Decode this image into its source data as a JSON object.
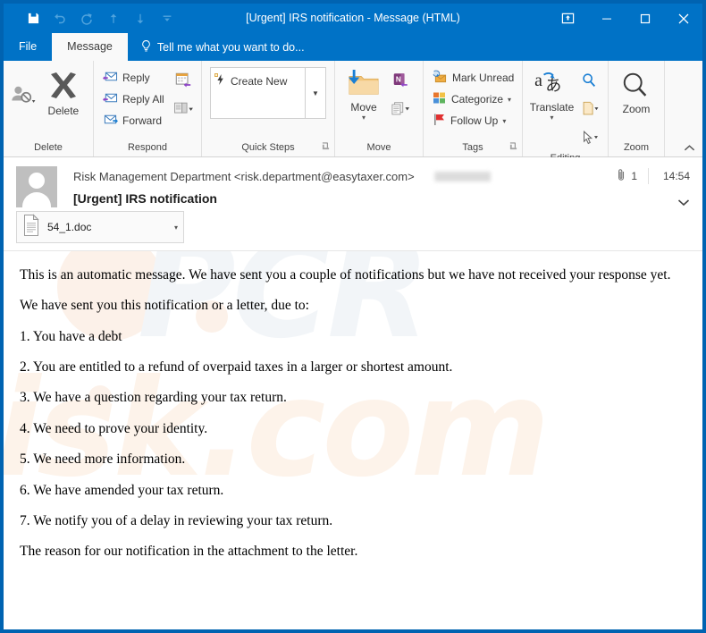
{
  "window": {
    "title": "[Urgent] IRS notification - Message (HTML)",
    "border_color": "#0063B1",
    "titlebar_color": "#0072C6"
  },
  "quick_access_toolbar": {
    "buttons": [
      {
        "name": "save-button",
        "icon": "save-icon",
        "label": "Save",
        "enabled": true
      },
      {
        "name": "undo-button",
        "icon": "undo-icon",
        "label": "Undo",
        "enabled": false
      },
      {
        "name": "redo-button",
        "icon": "redo-icon",
        "label": "Redo",
        "enabled": false
      },
      {
        "name": "previous-item-button",
        "icon": "arrow-up-icon",
        "label": "Previous Item",
        "enabled": false
      },
      {
        "name": "next-item-button",
        "icon": "arrow-down-icon",
        "label": "Next Item",
        "enabled": false
      },
      {
        "name": "customize-qat-button",
        "icon": "chevron-down-icon",
        "label": "Customize Quick Access Toolbar",
        "enabled": false
      }
    ]
  },
  "window_controls": {
    "ribbon_display_options": "ribbon-display-options-icon",
    "minimize": "minimize-icon",
    "maximize": "maximize-icon",
    "close": "close-icon"
  },
  "tabs": {
    "file": "File",
    "message": "Message",
    "active": "Message",
    "tell_me": "Tell me what you want to do...",
    "tell_me_icon": "lightbulb-icon"
  },
  "ribbon": {
    "collapse_icon": "chevron-up-icon",
    "groups": [
      {
        "key": "delete",
        "label": "Delete",
        "ignore_label": "Ignore",
        "delete_label": "Delete",
        "ignore_icon": "ignore-person-icon",
        "delete_icon": "delete-x-icon"
      },
      {
        "key": "respond",
        "label": "Respond",
        "items": [
          {
            "label": "Reply",
            "icon": "reply-envelope-icon"
          },
          {
            "label": "Reply All",
            "icon": "reply-all-envelope-icon"
          },
          {
            "label": "Forward",
            "icon": "forward-envelope-icon"
          }
        ],
        "extra_icons": [
          {
            "name": "meeting-icon",
            "label": "Meeting"
          },
          {
            "name": "more-respond-actions-icon",
            "label": "More Respond Actions"
          }
        ]
      },
      {
        "key": "quick-steps",
        "label": "Quick Steps",
        "item_label": "Create New",
        "item_icon": "quick-step-lightning-icon",
        "more_icon": "chevron-down-icon",
        "launcher_icon": "dialog-launcher-icon"
      },
      {
        "key": "move",
        "label": "Move",
        "move_label": "Move",
        "move_icon": "move-folder-icon",
        "extra_icons": [
          {
            "name": "onenote-icon",
            "label": "OneNote"
          },
          {
            "name": "rules-icon",
            "label": "Rules"
          }
        ]
      },
      {
        "key": "tags",
        "label": "Tags",
        "items": [
          {
            "label": "Mark Unread",
            "icon": "mark-unread-icon",
            "has_caret": false
          },
          {
            "label": "Categorize",
            "icon": "categorize-icon",
            "has_caret": true
          },
          {
            "label": "Follow Up",
            "icon": "follow-up-flag-icon",
            "has_caret": true
          }
        ],
        "launcher_icon": "dialog-launcher-icon"
      },
      {
        "key": "editing",
        "label": "Editing",
        "translate_label": "Translate",
        "translate_icon": "translate-icon",
        "extra_icons": [
          {
            "name": "find-icon",
            "label": "Find"
          },
          {
            "name": "related-icon",
            "label": "Related"
          },
          {
            "name": "select-icon",
            "label": "Select"
          }
        ]
      },
      {
        "key": "zoom",
        "label": "Zoom",
        "zoom_label": "Zoom",
        "zoom_icon": "magnifier-icon"
      }
    ]
  },
  "message": {
    "avatar_icon": "contact-avatar-icon",
    "sender": "Risk Management Department <risk.department@easytaxer.com>",
    "recipient_redacted": true,
    "attachment_count": "1",
    "attachment_icon": "paperclip-icon",
    "time": "14:54",
    "subject": "[Urgent] IRS notification",
    "expand_icon": "chevron-down-icon",
    "attachments": [
      {
        "filename": "54_1.doc",
        "icon": "document-icon",
        "caret_icon": "chevron-down-icon"
      }
    ],
    "body_paragraphs": [
      "This is an automatic message. We have sent you a couple of notifications but we have not received your response yet.",
      "We have sent you this notification or a letter, due to:",
      "1. You have a debt",
      "2. You are entitled to a refund of overpaid taxes in a larger or shortest amount.",
      "3. We have a question regarding your tax return.",
      "4. We need to prove your identity.",
      "5. We need more information.",
      "6. We have amended your tax return.",
      "7. We notify you of a delay in reviewing your tax return.",
      "The reason for our notification in the attachment to the letter."
    ]
  },
  "watermark": {
    "text_top": "PCR",
    "text_bottom": "isk.com"
  }
}
